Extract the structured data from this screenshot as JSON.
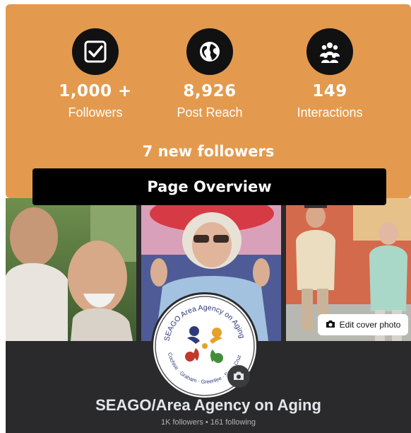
{
  "stats": [
    {
      "icon": "checkbox-icon",
      "value": "1,000 +",
      "label": "Followers"
    },
    {
      "icon": "globe-icon",
      "value": "8,926",
      "label": "Post Reach"
    },
    {
      "icon": "group-icon",
      "value": "149",
      "label": "Interactions"
    }
  ],
  "new_followers": "7 new followers",
  "overview_title": "Page Overview",
  "cover": {
    "edit_label": "Edit cover photo"
  },
  "logo": {
    "ring_text_top": "SEAGO Area Agency on Aging",
    "ring_text_bottom": "Cochise · Graham · Greenlee · Santa Cruz"
  },
  "page": {
    "name": "SEAGO/Area Agency on Aging",
    "meta": "1K followers • 161 following"
  },
  "colors": {
    "card_orange": "#e39a4e",
    "dark_bg": "#2a2a2c",
    "black": "#000000"
  }
}
